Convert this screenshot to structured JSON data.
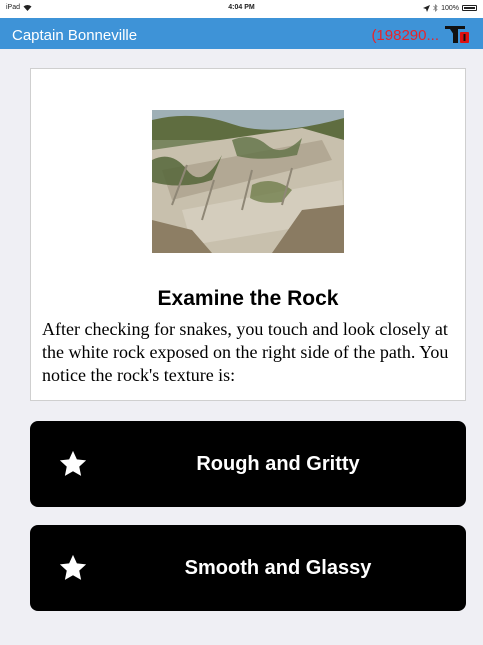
{
  "status_bar": {
    "device": "iPad",
    "time": "4:04 PM",
    "battery": "100%"
  },
  "nav": {
    "title": "Captain Bonneville",
    "user_id": "(198290..."
  },
  "card": {
    "title": "Examine the Rock",
    "body": "After checking for snakes, you touch and look closely at the white rock exposed on the right side of the path. You notice the rock's texture is:"
  },
  "choices": [
    {
      "label": "Rough and Gritty",
      "icon": "star-icon"
    },
    {
      "label": "Smooth and Glassy",
      "icon": "star-icon"
    }
  ],
  "colors": {
    "nav_background": "#3e93d7",
    "user_id_text": "#e8242a",
    "choice_background": "#000000",
    "page_background": "#efeff4"
  }
}
